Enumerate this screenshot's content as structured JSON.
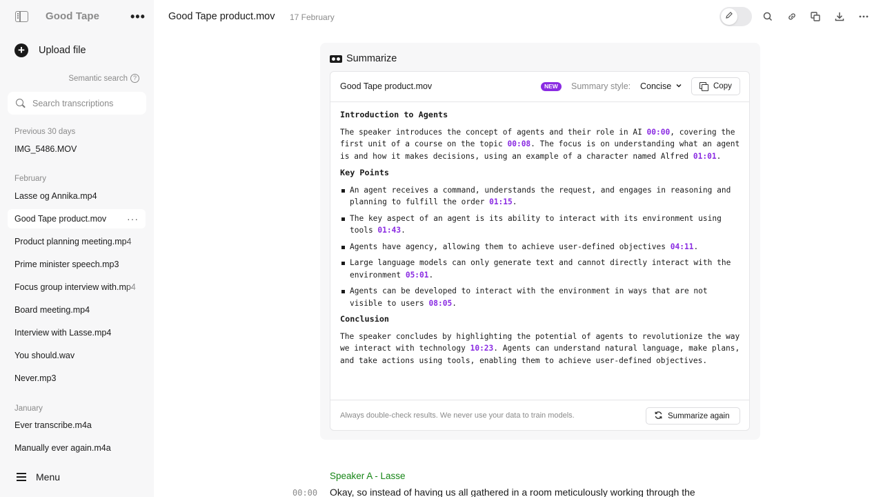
{
  "sidebar": {
    "brand": "Good Tape",
    "upload_label": "Upload file",
    "semantic_search_label": "Semantic search",
    "search_placeholder": "Search transcriptions",
    "sections": [
      {
        "label": "Previous 30 days",
        "items": [
          "IMG_5486.MOV"
        ]
      },
      {
        "label": "February",
        "items": [
          "Lasse og Annika.mp4",
          "Good Tape product.mov",
          "Product planning meeting.mp4",
          "Prime minister speech.mp3",
          "Focus group interview with.mp4",
          "Board meeting.mp4",
          "Interview with Lasse.mp4",
          "You should.wav",
          "Never.mp3"
        ]
      },
      {
        "label": "January",
        "items": [
          "Ever transcribe.m4a",
          "Manually ever again.m4a"
        ]
      }
    ],
    "active_item": "Good Tape product.mov",
    "menu_label": "Menu"
  },
  "header": {
    "title": "Good Tape product.mov",
    "date": "17 February",
    "icons": [
      "edit-icon",
      "search-icon",
      "link-icon",
      "copy-icon",
      "download-icon",
      "more-icon"
    ]
  },
  "summary": {
    "title": "Summarize",
    "file_name": "Good Tape product.mov",
    "badge": "NEW",
    "style_label": "Summary style:",
    "style_value": "Concise",
    "copy_label": "Copy",
    "intro_heading": "Introduction to Agents",
    "intro": [
      {
        "text": "The speaker introduces the concept of agents and their role in AI "
      },
      {
        "ts": "00:00"
      },
      {
        "text": ", covering the first unit of a course on the topic "
      },
      {
        "ts": "00:08"
      },
      {
        "text": ". The focus is on understanding what an agent is and how it makes decisions, using an example of a character named Alfred "
      },
      {
        "ts": "01:01"
      },
      {
        "text": "."
      }
    ],
    "key_points_heading": "Key Points",
    "key_points": [
      {
        "text": "An agent receives a command, understands the request, and engages in reasoning and planning to fulfill the order ",
        "ts": "01:15"
      },
      {
        "text": "The key aspect of an agent is its ability to interact with its environment using tools ",
        "ts": "01:43"
      },
      {
        "text": "Agents have agency, allowing them to achieve user-defined objectives ",
        "ts": "04:11"
      },
      {
        "text": "Large language models can only generate text and cannot directly interact with the environment ",
        "ts": "05:01"
      },
      {
        "text": "Agents can be developed to interact with the environment in ways that are not visible to users ",
        "ts": "08:05"
      }
    ],
    "conclusion_heading": "Conclusion",
    "conclusion": [
      {
        "text": "The speaker concludes by highlighting the potential of agents to revolutionize the way we interact with technology "
      },
      {
        "ts": "10:23"
      },
      {
        "text": ". Agents can understand natural language, make plans, and take actions using tools, enabling them to achieve user-defined objectives."
      }
    ],
    "footer_note": "Always double-check results. We never use your data to train models.",
    "again_label": "Summarize again"
  },
  "transcript": {
    "speaker": "Speaker A - Lasse",
    "time": "00:00",
    "text": "Okay, so instead of having us all gathered in a room meticulously working through the"
  },
  "colors": {
    "accent": "#8a2be2",
    "speaker": "#168516"
  }
}
